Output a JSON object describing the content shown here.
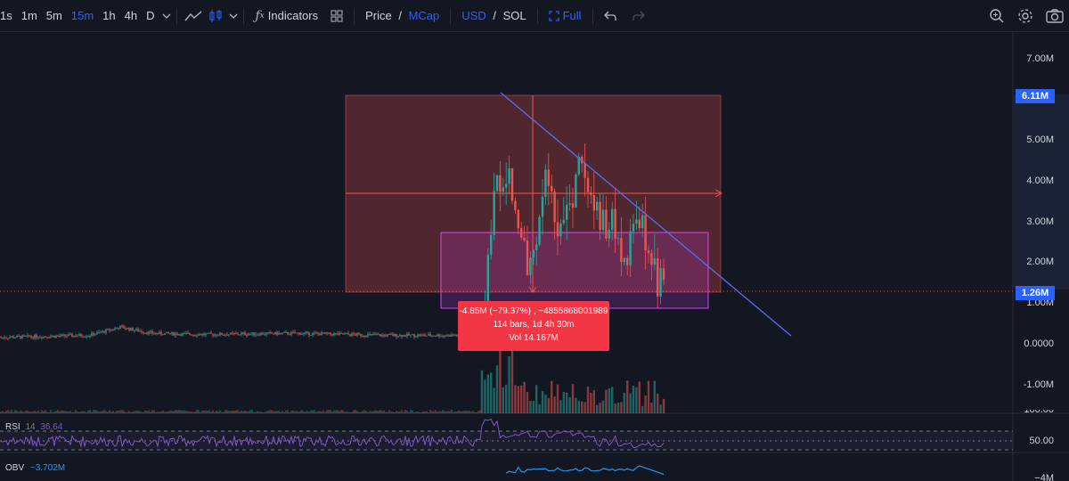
{
  "toolbar": {
    "timeframes": [
      "1s",
      "1m",
      "5m",
      "15m",
      "1h",
      "4h",
      "D"
    ],
    "active_timeframe": "15m",
    "indicators_label": "Indicators",
    "price_label": "Price",
    "slash": " / ",
    "mcap_label": "MCap",
    "usd_label": "USD",
    "sol_label": "SOL",
    "full_label": "Full"
  },
  "colors": {
    "background": "#131722",
    "up": "#26a69a",
    "down": "#ef5350",
    "accent": "#2962ff",
    "rsi_line": "#7e57c2",
    "obv_line": "#2196f3",
    "trendline": "#5b6cf0"
  },
  "price_axis": {
    "labels": [
      "7.00M",
      "5.00M",
      "4.00M",
      "3.00M",
      "2.00M",
      "1.00M",
      "0.0000",
      "-1.00M"
    ],
    "current_top": "6.11M",
    "current_price": "1.26M"
  },
  "measure_tooltip": {
    "line1": "-4.85M (−79.37%) , −4855868001989",
    "line2": "114 bars, 1d 4h 30m",
    "line3": "Vol 14.167M"
  },
  "rsi": {
    "label": "RSI",
    "period": "14",
    "value": "36.64",
    "axis_top": "100.00",
    "axis_mid": "50.00"
  },
  "obv": {
    "label": "OBV",
    "value": "−3.702M",
    "axis": "−4M"
  },
  "chart_data": {
    "type": "candlestick",
    "y_unit": "market cap (USD)",
    "ylim": [
      -1400000,
      7600000
    ],
    "position_box": {
      "top": 6110000,
      "bottom": 1260000,
      "entry": 3700000
    },
    "measure_box": {
      "top": 2750000,
      "bottom": 880000
    },
    "current_price": 1260000,
    "trendline": {
      "from": 6050000,
      "to": 230000
    },
    "indicators": [
      "Volume",
      "RSI 14",
      "OBV"
    ]
  }
}
